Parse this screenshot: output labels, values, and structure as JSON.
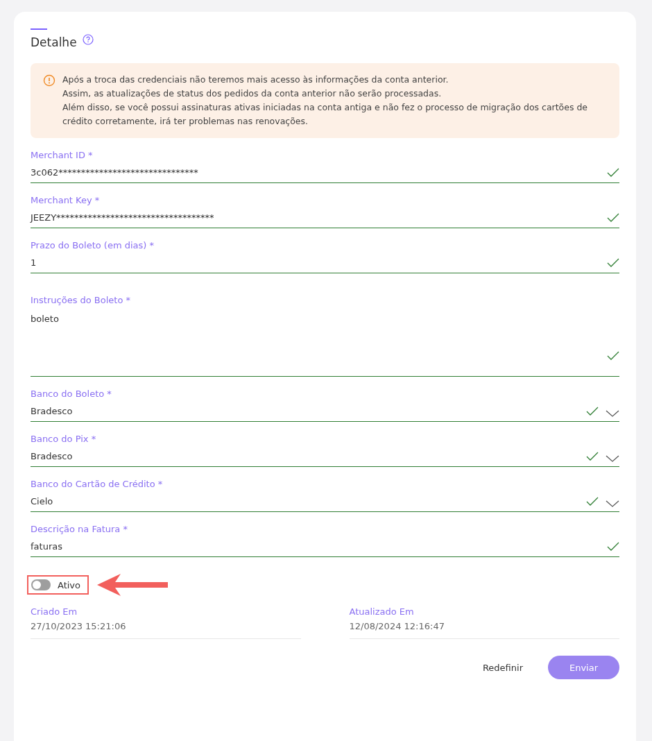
{
  "section": {
    "title": "Detalhe"
  },
  "alert": {
    "lines": [
      "Após a troca das credenciais não teremos mais acesso às informações da conta anterior.",
      "Assim, as atualizações de status dos pedidos da conta anterior não serão processadas.",
      "Além disso, se você possui assinaturas ativas iniciadas na conta antiga e não fez o processo de migração dos cartões de crédito corretamente, irá ter problemas nas renovações."
    ]
  },
  "fields": [
    {
      "kind": "text",
      "label": "Merchant ID *",
      "value": "3c062*******************************",
      "valid": true
    },
    {
      "kind": "text",
      "label": "Merchant Key *",
      "value": "JEEZY***********************************",
      "valid": true
    },
    {
      "kind": "text",
      "label": "Prazo do Boleto (em dias) *",
      "value": "1",
      "valid": true
    },
    {
      "kind": "textarea",
      "label": "Instruções do Boleto *",
      "value": "boleto",
      "valid": true
    },
    {
      "kind": "select",
      "label": "Banco do Boleto *",
      "value": "Bradesco",
      "valid": true
    },
    {
      "kind": "select",
      "label": "Banco do Pix *",
      "value": "Bradesco",
      "valid": true
    },
    {
      "kind": "select",
      "label": "Banco do Cartão de Crédito *",
      "value": "Cielo",
      "valid": true
    },
    {
      "kind": "text",
      "label": "Descrição na Fatura *",
      "value": "faturas",
      "valid": true
    }
  ],
  "toggle": {
    "label": "Ativo",
    "on": false
  },
  "dates": [
    {
      "label": "Criado Em",
      "value": "27/10/2023 15:21:06"
    },
    {
      "label": "Atualizado Em",
      "value": "12/08/2024 12:16:47"
    }
  ],
  "buttons": [
    {
      "label": "Redefinir",
      "kind": "text",
      "disabled": false
    },
    {
      "label": "Enviar",
      "kind": "primary",
      "disabled": true
    }
  ]
}
